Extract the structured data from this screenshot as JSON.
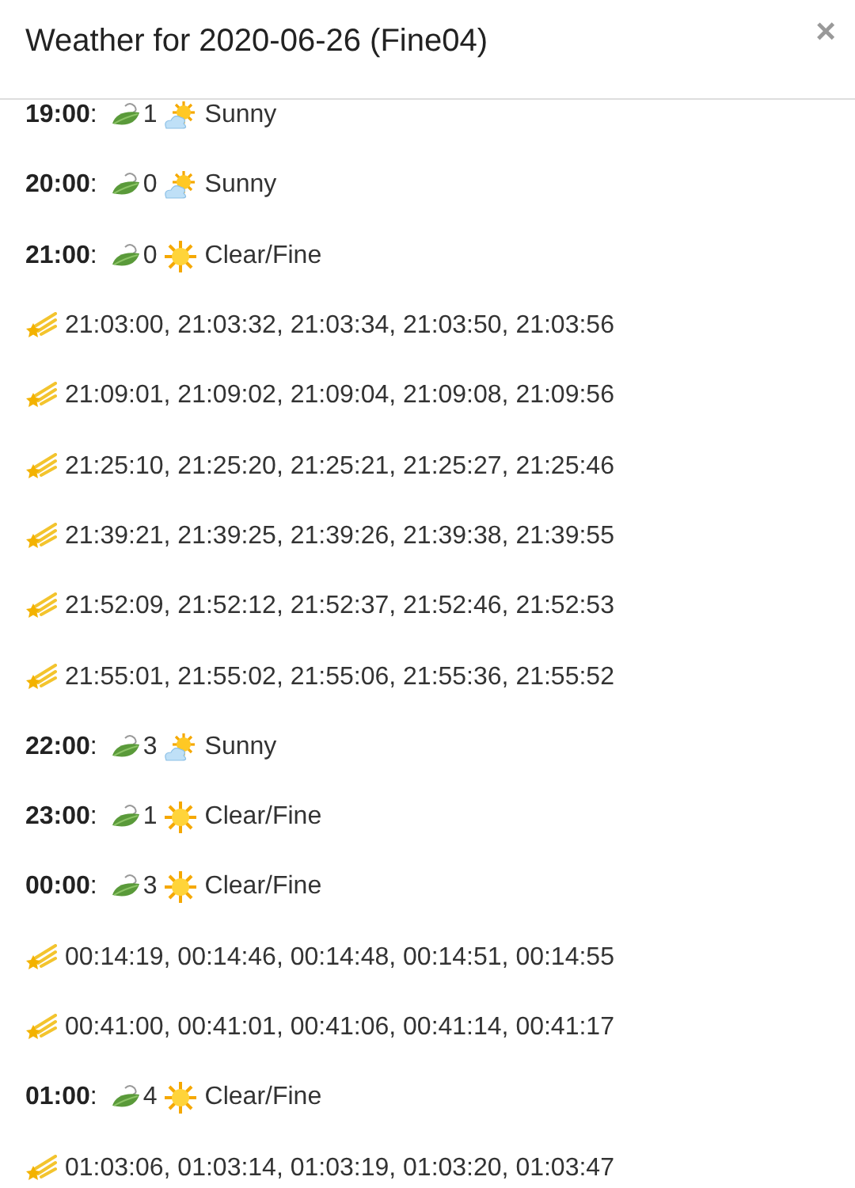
{
  "dialog": {
    "title": "Weather for 2020-06-26 (Fine04)",
    "close": "×"
  },
  "rows": [
    {
      "kind": "hour",
      "time": "**19:00**:",
      "wind": "1",
      "sky": {
        "kind": "sun_cloud"
      },
      "weather": "Sunny"
    },
    {
      "kind": "hour",
      "time": "**20:00**:",
      "wind": "0",
      "sky": {
        "kind": "sun_cloud"
      },
      "weather": "Sunny"
    },
    {
      "kind": "hour",
      "time": "**21:00**:",
      "wind": "0",
      "sky": {
        "kind": "sun"
      },
      "weather": "Clear/Fine"
    },
    {
      "kind": "meteors",
      "text": "21:03:00, 21:03:32, 21:03:34, 21:03:50, 21:03:56"
    },
    {
      "kind": "meteors",
      "text": "21:09:01, 21:09:02, 21:09:04, 21:09:08, 21:09:56"
    },
    {
      "kind": "meteors",
      "text": "21:25:10, 21:25:20, 21:25:21, 21:25:27, 21:25:46"
    },
    {
      "kind": "meteors",
      "text": "21:39:21, 21:39:25, 21:39:26, 21:39:38, 21:39:55"
    },
    {
      "kind": "meteors",
      "text": "21:52:09, 21:52:12, 21:52:37, 21:52:46, 21:52:53"
    },
    {
      "kind": "meteors",
      "text": "21:55:01, 21:55:02, 21:55:06, 21:55:36, 21:55:52"
    },
    {
      "kind": "hour",
      "time": "**22:00**:",
      "wind": "3",
      "sky": {
        "kind": "sun_cloud"
      },
      "weather": "Sunny"
    },
    {
      "kind": "hour",
      "time": "**23:00**:",
      "wind": "1",
      "sky": {
        "kind": "sun"
      },
      "weather": "Clear/Fine"
    },
    {
      "kind": "hour",
      "time": "**00:00**:",
      "wind": "3",
      "sky": {
        "kind": "sun"
      },
      "weather": "Clear/Fine"
    },
    {
      "kind": "meteors",
      "text": "00:14:19, 00:14:46, 00:14:48, 00:14:51, 00:14:55"
    },
    {
      "kind": "meteors",
      "text": "00:41:00, 00:41:01, 00:41:06, 00:41:14, 00:41:17"
    },
    {
      "kind": "hour",
      "time": "**01:00**:",
      "wind": "4",
      "sky": {
        "kind": "sun"
      },
      "weather": "Clear/Fine"
    },
    {
      "kind": "meteors",
      "text": "01:03:06, 01:03:14, 01:03:19, 01:03:20, 01:03:47"
    }
  ]
}
